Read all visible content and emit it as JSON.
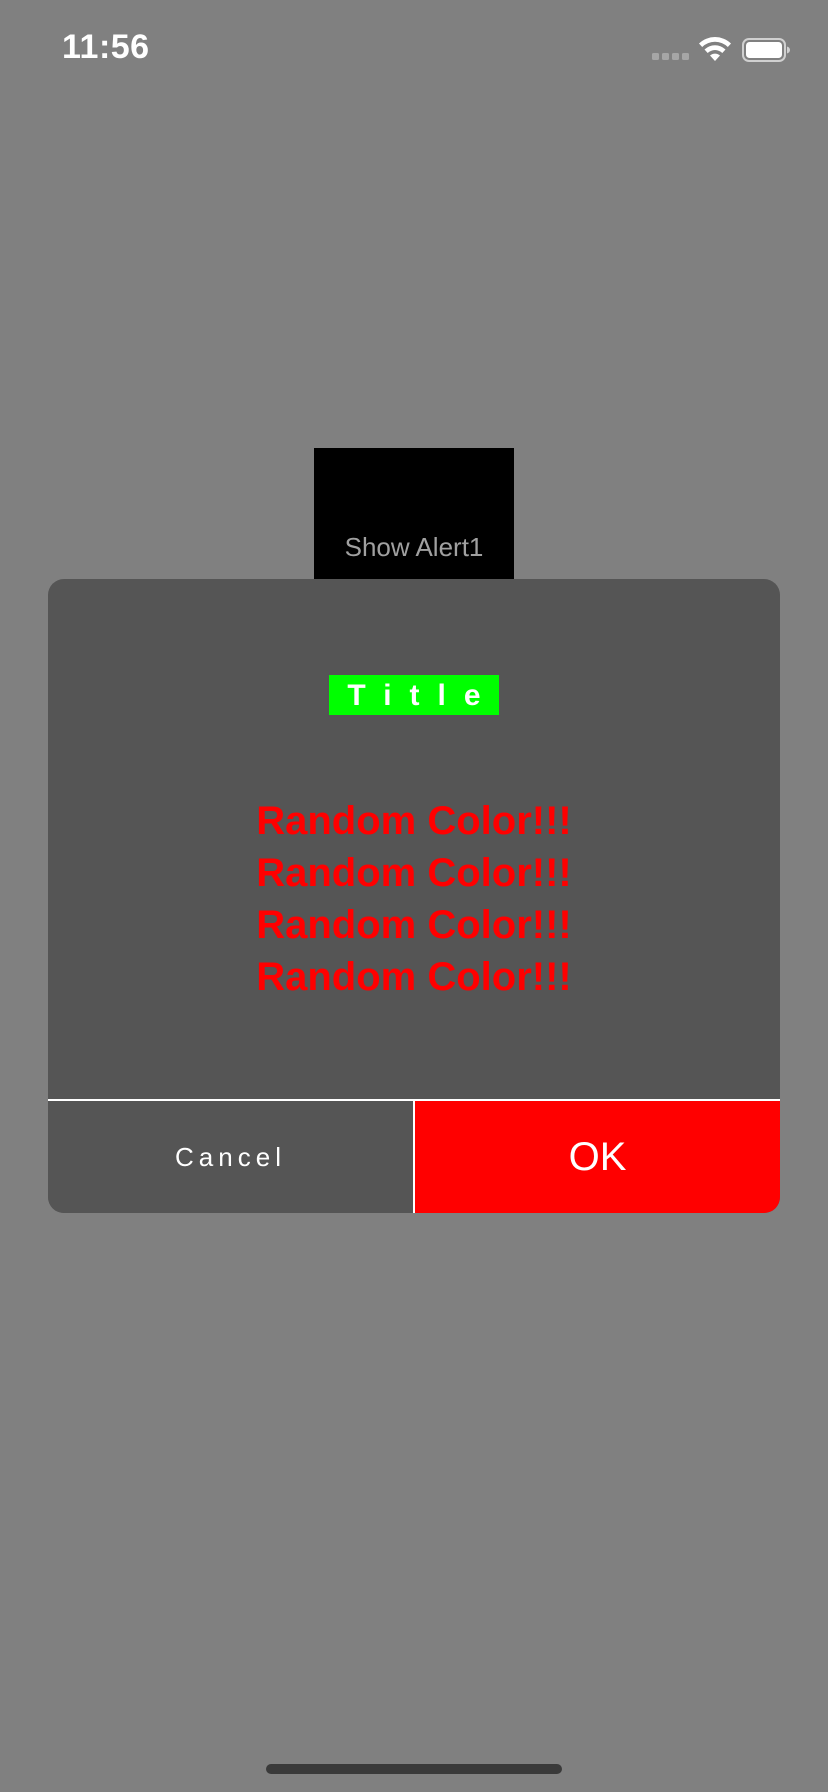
{
  "status_bar": {
    "time": "11:56",
    "signal_icon": "cellular-signal-icon",
    "wifi_icon": "wifi-icon",
    "battery_icon": "battery-icon"
  },
  "background": {
    "button_label": "Show Alert1"
  },
  "alert": {
    "title": "Title",
    "message_lines": [
      "Random Color!!!",
      "Random Color!!!",
      "Random Color!!!",
      "Random Color!!!"
    ],
    "cancel_label": "Cancel",
    "ok_label": "OK"
  },
  "colors": {
    "backdrop": "#808080",
    "alert_background": "#555555",
    "title_background": "#00ff00",
    "message_text": "#ff0000",
    "ok_background": "#ff0000"
  }
}
